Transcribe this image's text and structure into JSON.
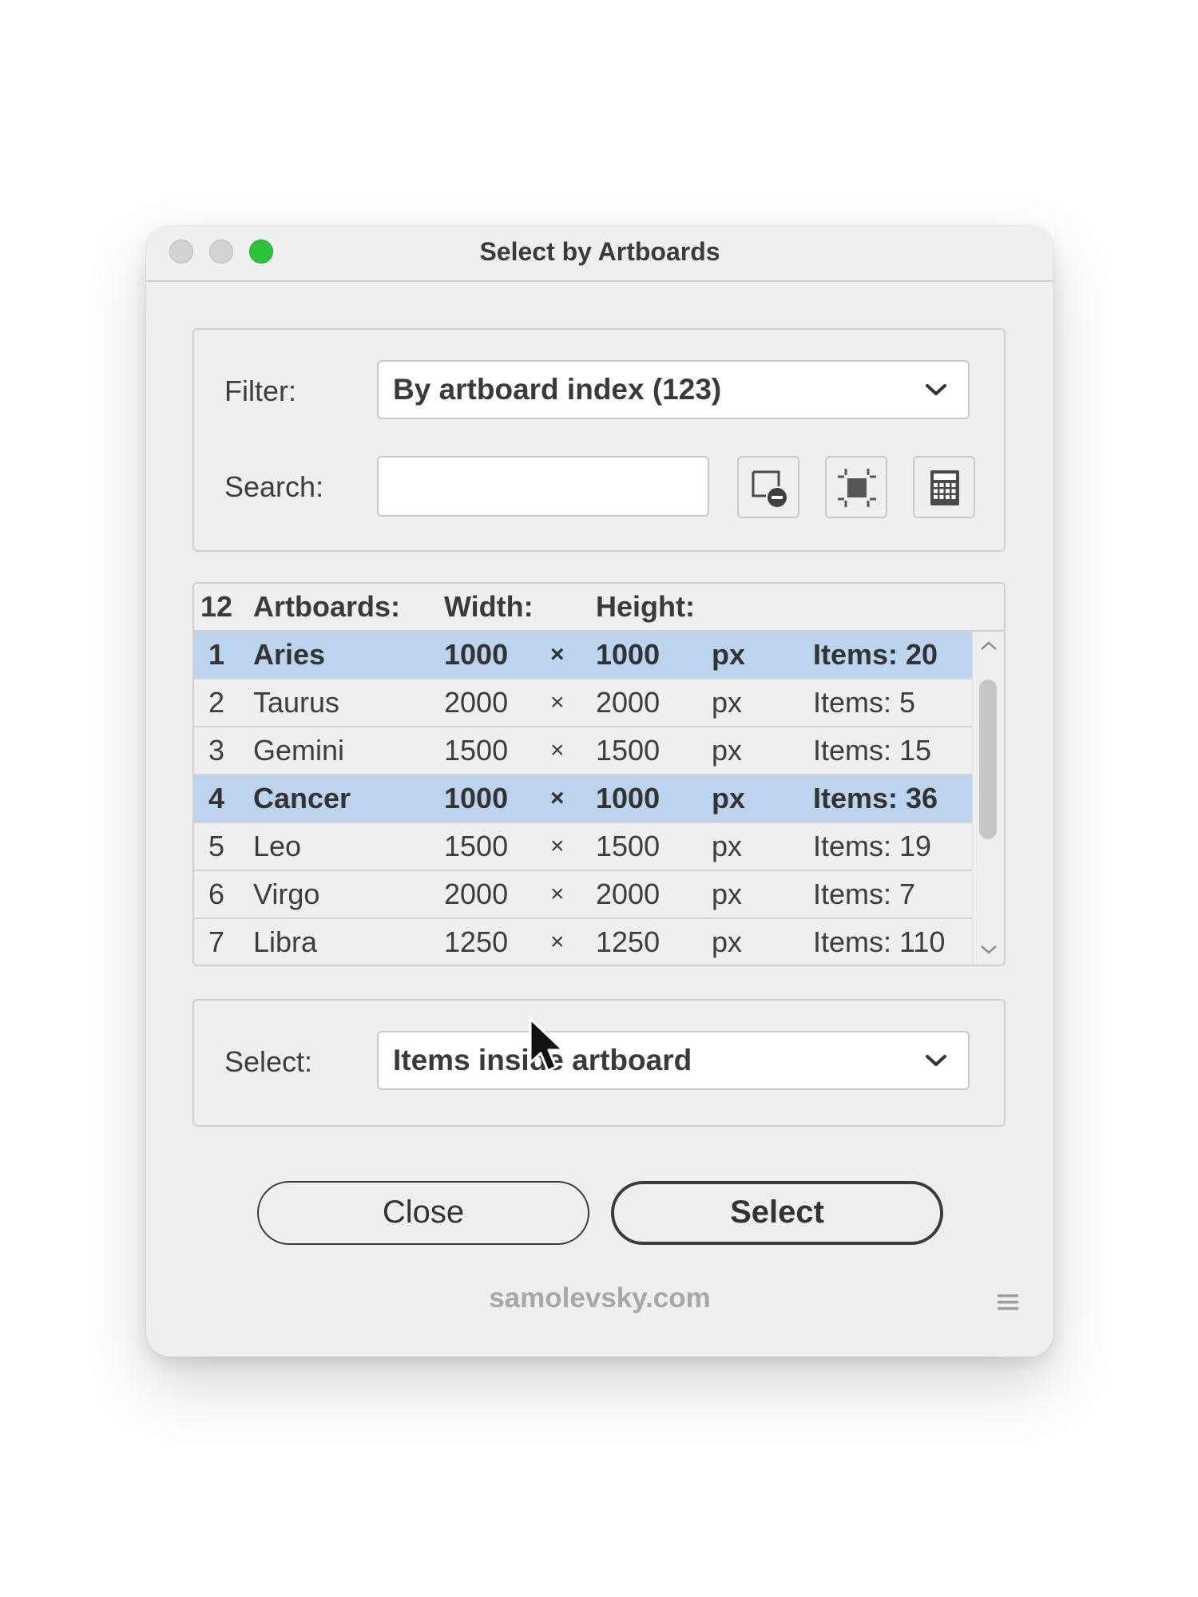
{
  "window": {
    "title": "Select by Artboards"
  },
  "filter": {
    "label": "Filter:",
    "value": "By artboard index (123)",
    "search_label": "Search:",
    "search_value": "",
    "search_placeholder": "",
    "icons": [
      "remove-artboard-icon",
      "fit-artboard-icon",
      "calculator-icon"
    ]
  },
  "list": {
    "count": "12",
    "headers": {
      "name": "Artboards:",
      "width": "Width:",
      "height": "Height:"
    },
    "rows": [
      {
        "index": "1",
        "name": "Aries",
        "width": "1000",
        "sep": "×",
        "height": "1000",
        "unit": "px",
        "items": "Items: 20",
        "selected": true
      },
      {
        "index": "2",
        "name": "Taurus",
        "width": "2000",
        "sep": "×",
        "height": "2000",
        "unit": "px",
        "items": "Items: 5",
        "selected": false
      },
      {
        "index": "3",
        "name": "Gemini",
        "width": "1500",
        "sep": "×",
        "height": "1500",
        "unit": "px",
        "items": "Items: 15",
        "selected": false
      },
      {
        "index": "4",
        "name": "Cancer",
        "width": "1000",
        "sep": "×",
        "height": "1000",
        "unit": "px",
        "items": "Items: 36",
        "selected": true
      },
      {
        "index": "5",
        "name": "Leo",
        "width": "1500",
        "sep": "×",
        "height": "1500",
        "unit": "px",
        "items": "Items: 19",
        "selected": false
      },
      {
        "index": "6",
        "name": "Virgo",
        "width": "2000",
        "sep": "×",
        "height": "2000",
        "unit": "px",
        "items": "Items: 7",
        "selected": false
      },
      {
        "index": "7",
        "name": "Libra",
        "width": "1250",
        "sep": "×",
        "height": "1250",
        "unit": "px",
        "items": "Items: 110",
        "selected": false
      }
    ]
  },
  "select": {
    "label": "Select:",
    "value": "Items inside artboard"
  },
  "buttons": {
    "close": "Close",
    "select": "Select"
  },
  "footer": {
    "link": "samolevsky.com"
  },
  "colors": {
    "selection": "#bdd4ee",
    "traffic_green": "#2ac43a"
  }
}
